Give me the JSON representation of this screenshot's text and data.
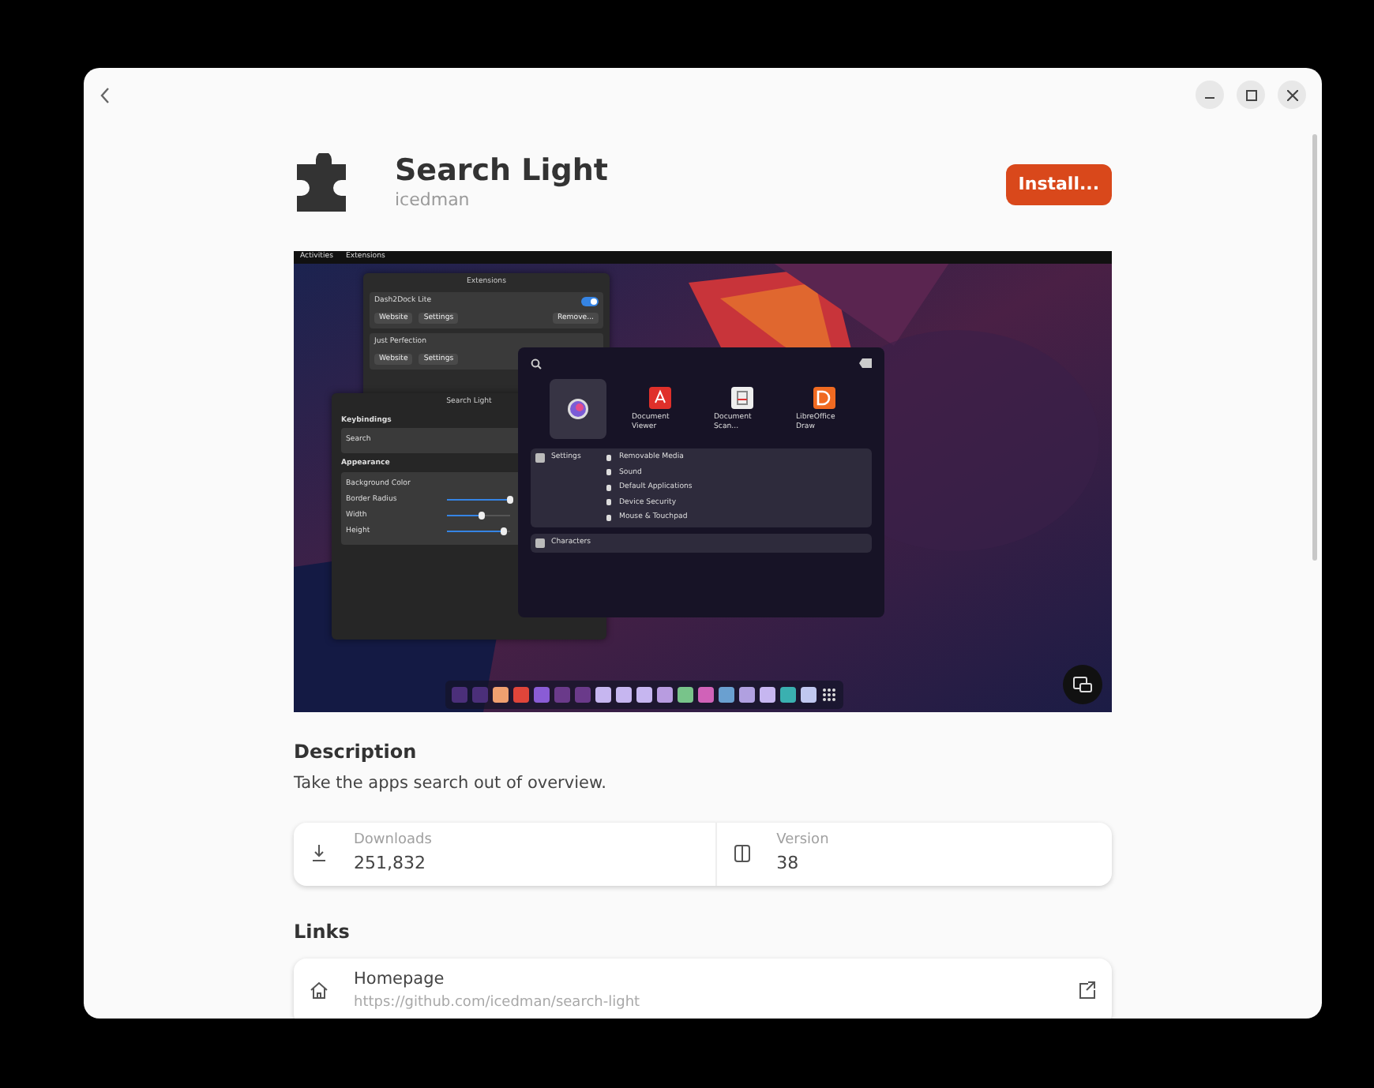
{
  "app": {
    "name": "Search Light",
    "author": "icedman",
    "install_button": "Install..."
  },
  "screenshot": {
    "top_bar": [
      "Activities",
      "Extensions"
    ],
    "extensions_window": {
      "title": "Extensions",
      "items": [
        {
          "name": "Dash2Dock Lite",
          "on": true,
          "buttons": [
            "Website",
            "Settings",
            "Remove..."
          ]
        },
        {
          "name": "Just Perfection",
          "buttons": [
            "Website",
            "Settings"
          ]
        }
      ]
    },
    "settings_window": {
      "title": "Search Light",
      "sections": [
        {
          "heading": "Keybindings",
          "rows": [
            {
              "label": "Search",
              "kind": "plain"
            }
          ]
        },
        {
          "heading": "Appearance",
          "rows": [
            {
              "label": "Background Color",
              "kind": "plain"
            },
            {
              "label": "Border Radius",
              "kind": "slider",
              "level": 1
            },
            {
              "label": "Width",
              "kind": "slider",
              "level": 0.55
            },
            {
              "label": "Height",
              "kind": "slider",
              "level": 0.9
            }
          ]
        }
      ]
    },
    "launcher": {
      "apps": [
        {
          "kind": "globe",
          "selected": true
        },
        {
          "kind": "pdf",
          "label": "Document Viewer",
          "selected": false
        },
        {
          "kind": "scanner",
          "label": "Document Scan...",
          "selected": false
        },
        {
          "kind": "draw",
          "label": "LibreOffice Draw",
          "selected": false
        }
      ],
      "results": [
        {
          "app": "Settings",
          "rows": [
            "Removable Media",
            "Sound",
            "Default Applications",
            "Device Security",
            "Mouse & Touchpad"
          ]
        },
        {
          "app": "Characters"
        }
      ]
    }
  },
  "description": {
    "heading": "Description",
    "text": "Take the apps search out of overview."
  },
  "stats": [
    {
      "kind": "downloads",
      "label": "Downloads",
      "value": "251,832"
    },
    {
      "kind": "version",
      "label": "Version",
      "value": "38"
    }
  ],
  "links": {
    "heading": "Links",
    "items": [
      {
        "kind": "home",
        "title": "Homepage",
        "url": "https://github.com/icedman/search-light"
      }
    ]
  }
}
